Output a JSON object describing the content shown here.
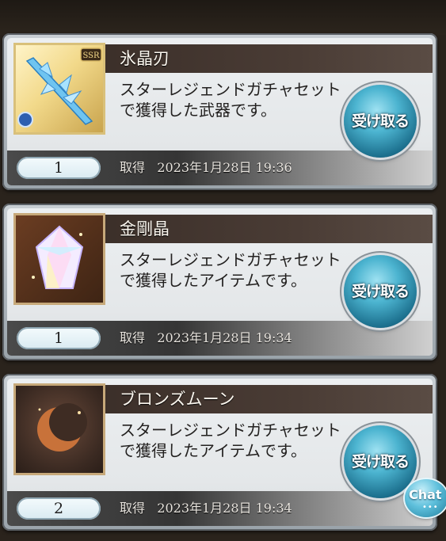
{
  "items": [
    {
      "name": "氷晶刃",
      "description": "スターレジェンドガチャセットで獲得した武器です。",
      "count": "1",
      "acquired_label": "取得",
      "acquired_date": "2023年1月28日 19:36",
      "rarity_badge": "SSR",
      "icon": "ice-crystal-blade-icon",
      "receive_label": "受け取る"
    },
    {
      "name": "金剛晶",
      "description": "スターレジェンドガチャセットで獲得したアイテムです。",
      "count": "1",
      "acquired_label": "取得",
      "acquired_date": "2023年1月28日 19:34",
      "icon": "diamond-crystal-icon",
      "receive_label": "受け取る"
    },
    {
      "name": "ブロンズムーン",
      "description": "スターレジェンドガチャセットで獲得したアイテムです。",
      "count": "2",
      "acquired_label": "取得",
      "acquired_date": "2023年1月28日 19:34",
      "icon": "bronze-moon-icon",
      "receive_label": "受け取る"
    }
  ],
  "chat_button_label": "Chat",
  "colors": {
    "title_bar": "#3b2f29",
    "receive_button": "#2f8fb0",
    "card_bg": "#e9ecee"
  }
}
